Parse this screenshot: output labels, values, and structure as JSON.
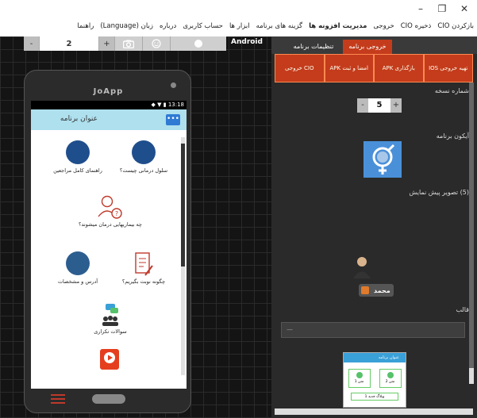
{
  "window": {
    "minimize_label": "–",
    "maximize_label": "❐",
    "close_label": "✕"
  },
  "menu": [
    {
      "label": "بازکردن CIO"
    },
    {
      "label": "ذخیره CIO"
    },
    {
      "label": "خروجی"
    },
    {
      "label": "مدیریت افزونه ها",
      "bold": true
    },
    {
      "label": "گزینه های برنامه"
    },
    {
      "label": "ابزار ها"
    },
    {
      "label": "حساب کاربری"
    },
    {
      "label": "درباره"
    },
    {
      "label": "زبان (Language)"
    },
    {
      "label": "راهنما"
    }
  ],
  "toolbar": {
    "minus_label": "-",
    "count_value": "2",
    "plus_label": "+",
    "platform_label": "Android"
  },
  "phone": {
    "brand": "JoApp",
    "status_time": "13:18",
    "app_title": "عنوان برنامه",
    "menu_dots": "•••",
    "items": {
      "item1": "سلول درمانی چیست؟",
      "item2": "راهنمای کامل مراجعین",
      "item3": "چه بیماریهایی درمان میشوند؟",
      "item4": "چگونه نوبت بگیریم؟",
      "item5": "آدرس و مشخصات",
      "item6": "سوالات تکراری"
    }
  },
  "right_panel": {
    "tab_output": "خروجی برنامه",
    "tab_settings": "تنظیمات برنامه",
    "subtabs": [
      "تهیه خروجی IOS",
      "بازگذاری APK",
      "امضا و ثبت APK",
      "CIO خروجی"
    ],
    "version_label": "شماره نسخه",
    "version_minus": "-",
    "version_value": "5",
    "version_plus": "+",
    "icon_label": "آیکون برنامه",
    "preview_label": "(5) تصویر پیش نمایش",
    "user_name": "محمد",
    "template_label": "قالب",
    "template_placeholder": "—",
    "preview_app_title": "عنوان برنامه",
    "preview_card1": "متن 1",
    "preview_card2": "متن 2",
    "preview_button": "وبلاگ جدید 1"
  }
}
